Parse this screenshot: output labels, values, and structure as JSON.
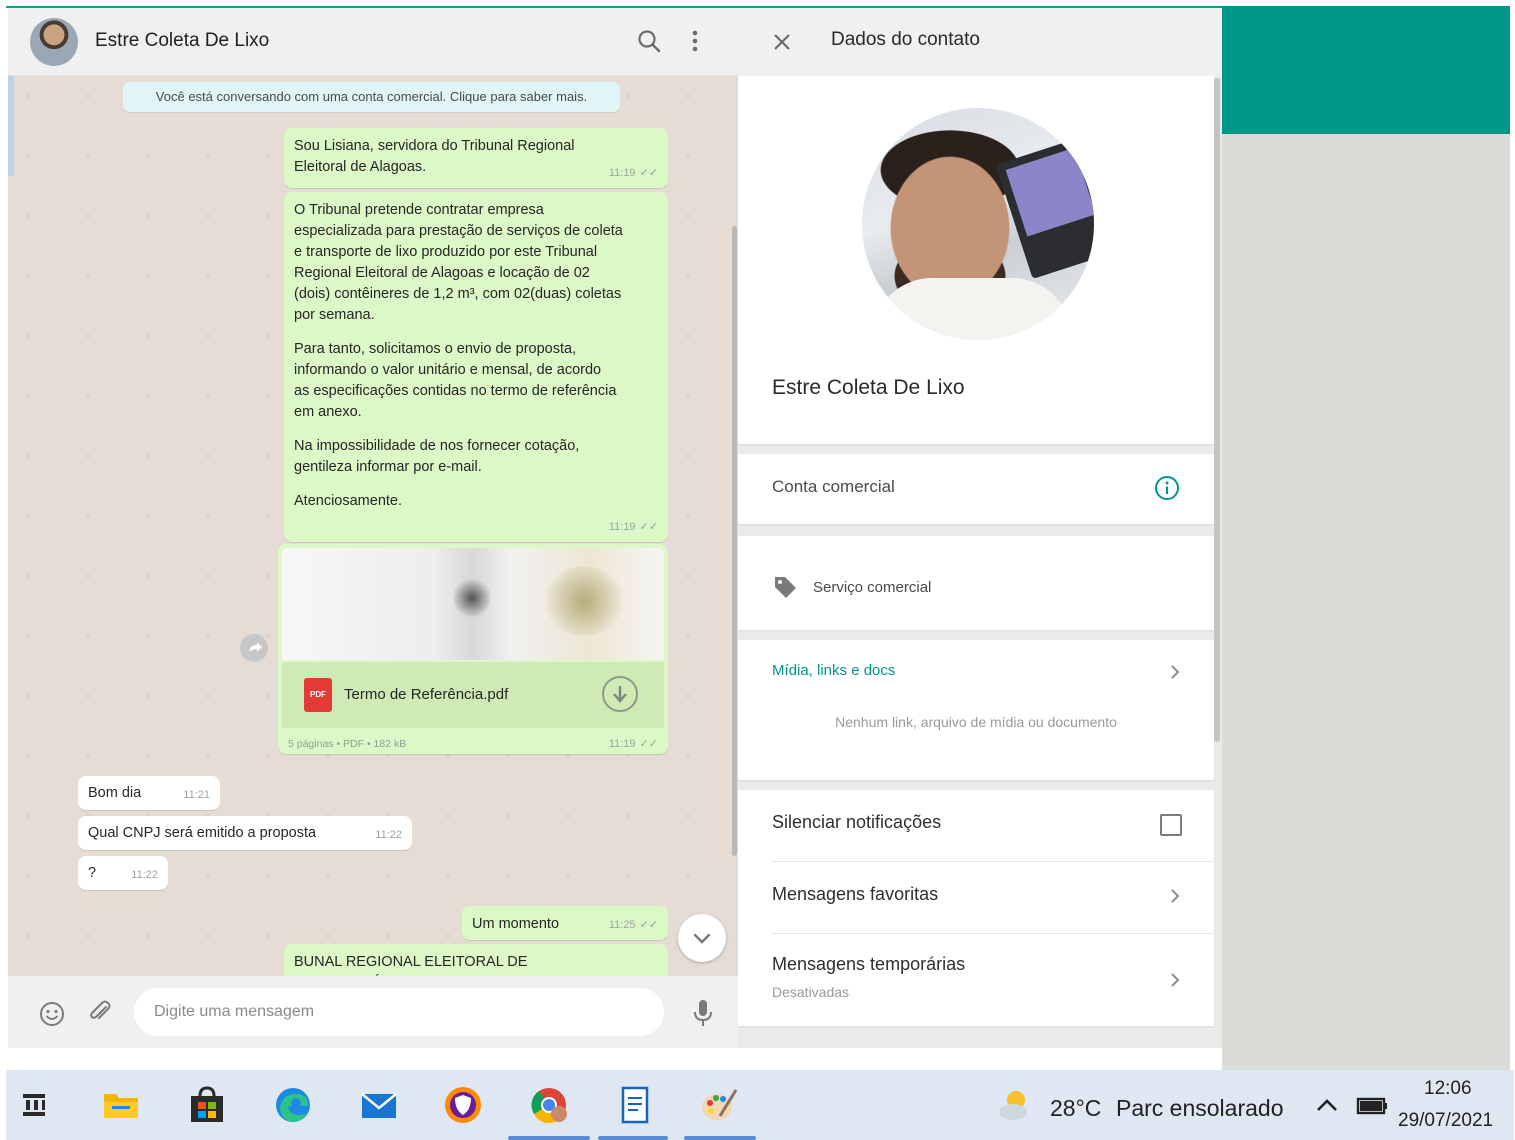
{
  "chat": {
    "contact_name": "Estre Coleta De Lixo",
    "business_note": "Você está conversando com uma conta comercial. Clique para saber mais.",
    "messages": [
      {
        "paragraphs": [
          "Sou Lisiana, servidora do Tribunal Regional\nEleitoral de Alagoas."
        ],
        "time": "11:19"
      },
      {
        "paragraphs": [
          "O Tribunal pretende contratar empresa\nespecializada para prestação de serviços de coleta\ne transporte de lixo produzido por este Tribunal\nRegional Eleitoral de Alagoas e locação de 02\n(dois) contêineres de 1,2 m³, com 02(duas) coletas\npor semana.",
          "Para tanto, solicitamos o envio de proposta,\ninformando o valor unitário e mensal, de acordo\nas especificações contidas no termo de referência\nem anexo.",
          "Na impossibilidade de nos fornecer cotação,\ngentileza informar por e-mail.",
          "Atenciosamente."
        ],
        "time": "11:19"
      }
    ],
    "document": {
      "icon_label": "PDF",
      "name": "Termo de Referência.pdf",
      "meta": "5 páginas • PDF • 182 kB",
      "time": "11:19"
    },
    "incoming": [
      {
        "text": "Bom dia",
        "time": "11:21"
      },
      {
        "text": "Qual CNPJ será emitido a proposta",
        "time": "11:22"
      },
      {
        "text": "?",
        "time": "11:22"
      }
    ],
    "reply": {
      "text": "Um momento",
      "time": "11:25"
    },
    "partial": "BUNAL REGIONAL ELEITORAL DE\nALAGOAS, Órgão do Poder Judiciário, em nome",
    "composer_placeholder": "Digite uma mensagem",
    "ticks": "✓✓"
  },
  "info": {
    "title": "Dados do contato",
    "name": "Estre Coleta De Lixo",
    "business_label": "Conta comercial",
    "service_label": "Serviço comercial",
    "media_label": "Mídia, links e docs",
    "media_empty": "Nenhum link, arquivo de mídia ou documento",
    "mute_label": "Silenciar notificações",
    "mute_checked": false,
    "starred_label": "Mensagens favoritas",
    "temporary_label": "Mensagens temporárias",
    "temporary_status": "Desativadas"
  },
  "taskbar": {
    "apps": [
      "task-view-icon",
      "file-explorer-icon",
      "store-icon",
      "edge-icon",
      "mail-icon",
      "vpn-shield-icon",
      "chrome-icon",
      "notepad-icon",
      "paint-icon"
    ],
    "active_apps": [
      "chrome-icon",
      "notepad-icon",
      "paint-icon"
    ],
    "weather_temp": "28°C",
    "weather_desc": "Parc ensolarado",
    "time": "12:06",
    "date": "29/07/2021"
  },
  "colors": {
    "accent": "#009688",
    "outgoing_bubble": "#dcf8c6",
    "incoming_bubble": "#ffffff",
    "chat_background": "#e5ddd5",
    "pdf_red": "#e53935"
  }
}
